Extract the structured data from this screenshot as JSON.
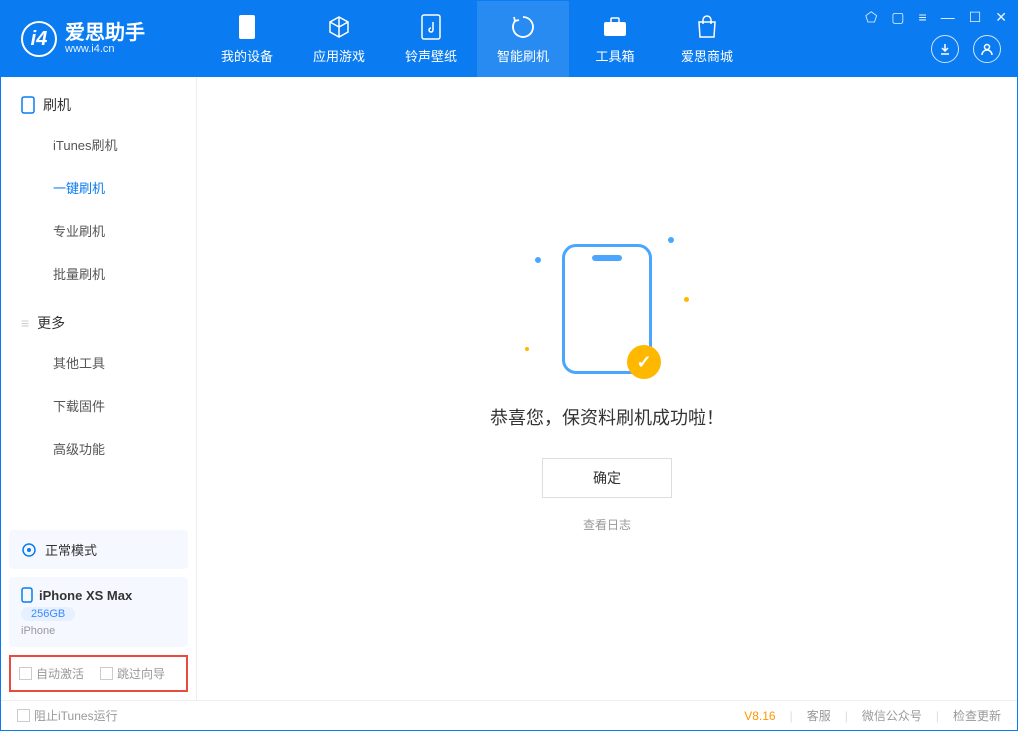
{
  "app": {
    "name": "爱思助手",
    "url": "www.i4.cn"
  },
  "tabs": [
    {
      "label": "我的设备"
    },
    {
      "label": "应用游戏"
    },
    {
      "label": "铃声壁纸"
    },
    {
      "label": "智能刷机"
    },
    {
      "label": "工具箱"
    },
    {
      "label": "爱思商城"
    }
  ],
  "sidebar": {
    "section1": {
      "title": "刷机"
    },
    "items1": [
      {
        "label": "iTunes刷机"
      },
      {
        "label": "一键刷机"
      },
      {
        "label": "专业刷机"
      },
      {
        "label": "批量刷机"
      }
    ],
    "section2": {
      "title": "更多"
    },
    "items2": [
      {
        "label": "其他工具"
      },
      {
        "label": "下载固件"
      },
      {
        "label": "高级功能"
      }
    ],
    "mode": "正常模式",
    "device": {
      "name": "iPhone XS Max",
      "storage": "256GB",
      "type": "iPhone"
    },
    "checks": {
      "auto_activate": "自动激活",
      "skip_guide": "跳过向导"
    }
  },
  "main": {
    "success_text": "恭喜您，保资料刷机成功啦！",
    "ok_button": "确定",
    "log_link": "查看日志"
  },
  "footer": {
    "block_itunes": "阻止iTunes运行",
    "version": "V8.16",
    "support": "客服",
    "wechat": "微信公众号",
    "update": "检查更新"
  }
}
